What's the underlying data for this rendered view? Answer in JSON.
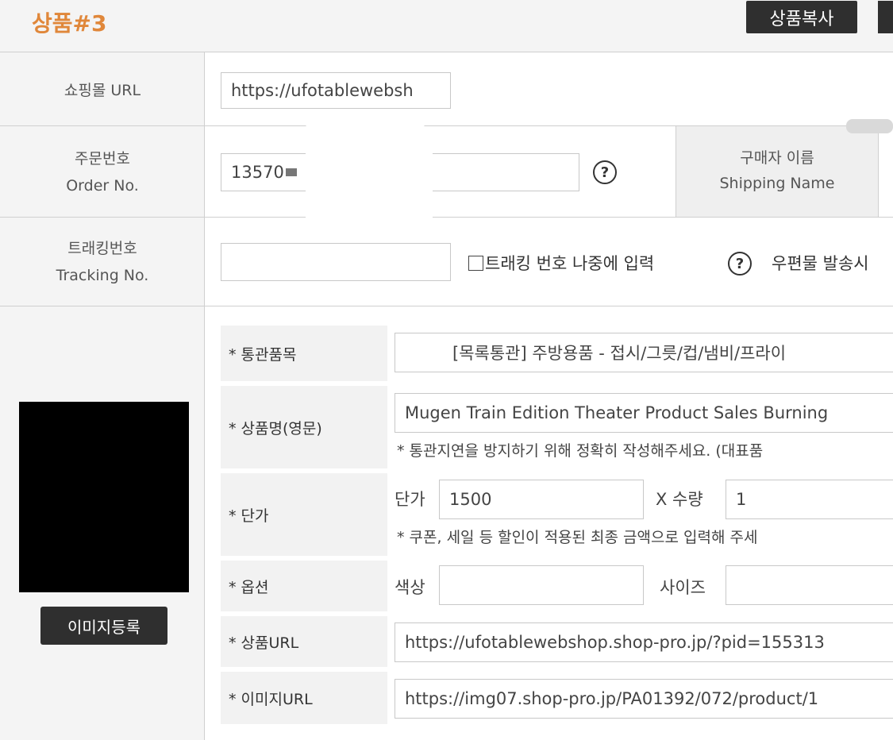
{
  "header": {
    "title": "상품#3",
    "copy_button": "상품복사"
  },
  "shopping_url": {
    "label": "쇼핑몰 URL",
    "value": "https://ufotablewebsh"
  },
  "order": {
    "label_ko": "주문번호",
    "label_en": "Order No.",
    "value": "13570",
    "help": "?"
  },
  "shipping_name": {
    "label_ko": "구매자 이름",
    "label_en": "Shipping Name"
  },
  "tracking": {
    "label_ko": "트래킹번호",
    "label_en": "Tracking No.",
    "value": "",
    "later_checkbox": "트래킹 번호 나중에 입력",
    "help": "?",
    "postal_text": "우편물 발송시"
  },
  "product": {
    "customs_label": "* 통관품목",
    "customs_value": "[목록통관] 주방용품 - 접시/그릇/컵/냄비/프라이",
    "name_label": "* 상품명(영문)",
    "name_value": "Mugen Train Edition Theater Product Sales Burning",
    "name_note": "* 통관지연을 방지하기 위해 정확히 작성해주세요. (대표품",
    "price_label": "* 단가",
    "unit_price_label": "단가",
    "unit_price_value": "1500",
    "qty_label": "X 수량",
    "qty_value": "1",
    "price_note": "* 쿠폰, 세일 등 할인이 적용된 최종 금액으로 입력해 주세",
    "option_label": "* 옵션",
    "color_label": "색상",
    "color_value": "",
    "size_label": "사이즈",
    "size_value": "",
    "url_label": "* 상품URL",
    "url_value": "https://ufotablewebshop.shop-pro.jp/?pid=155313",
    "image_url_label": "* 이미지URL",
    "image_url_value": "https://img07.shop-pro.jp/PA01392/072/product/1",
    "image_register_button": "이미지등록"
  }
}
